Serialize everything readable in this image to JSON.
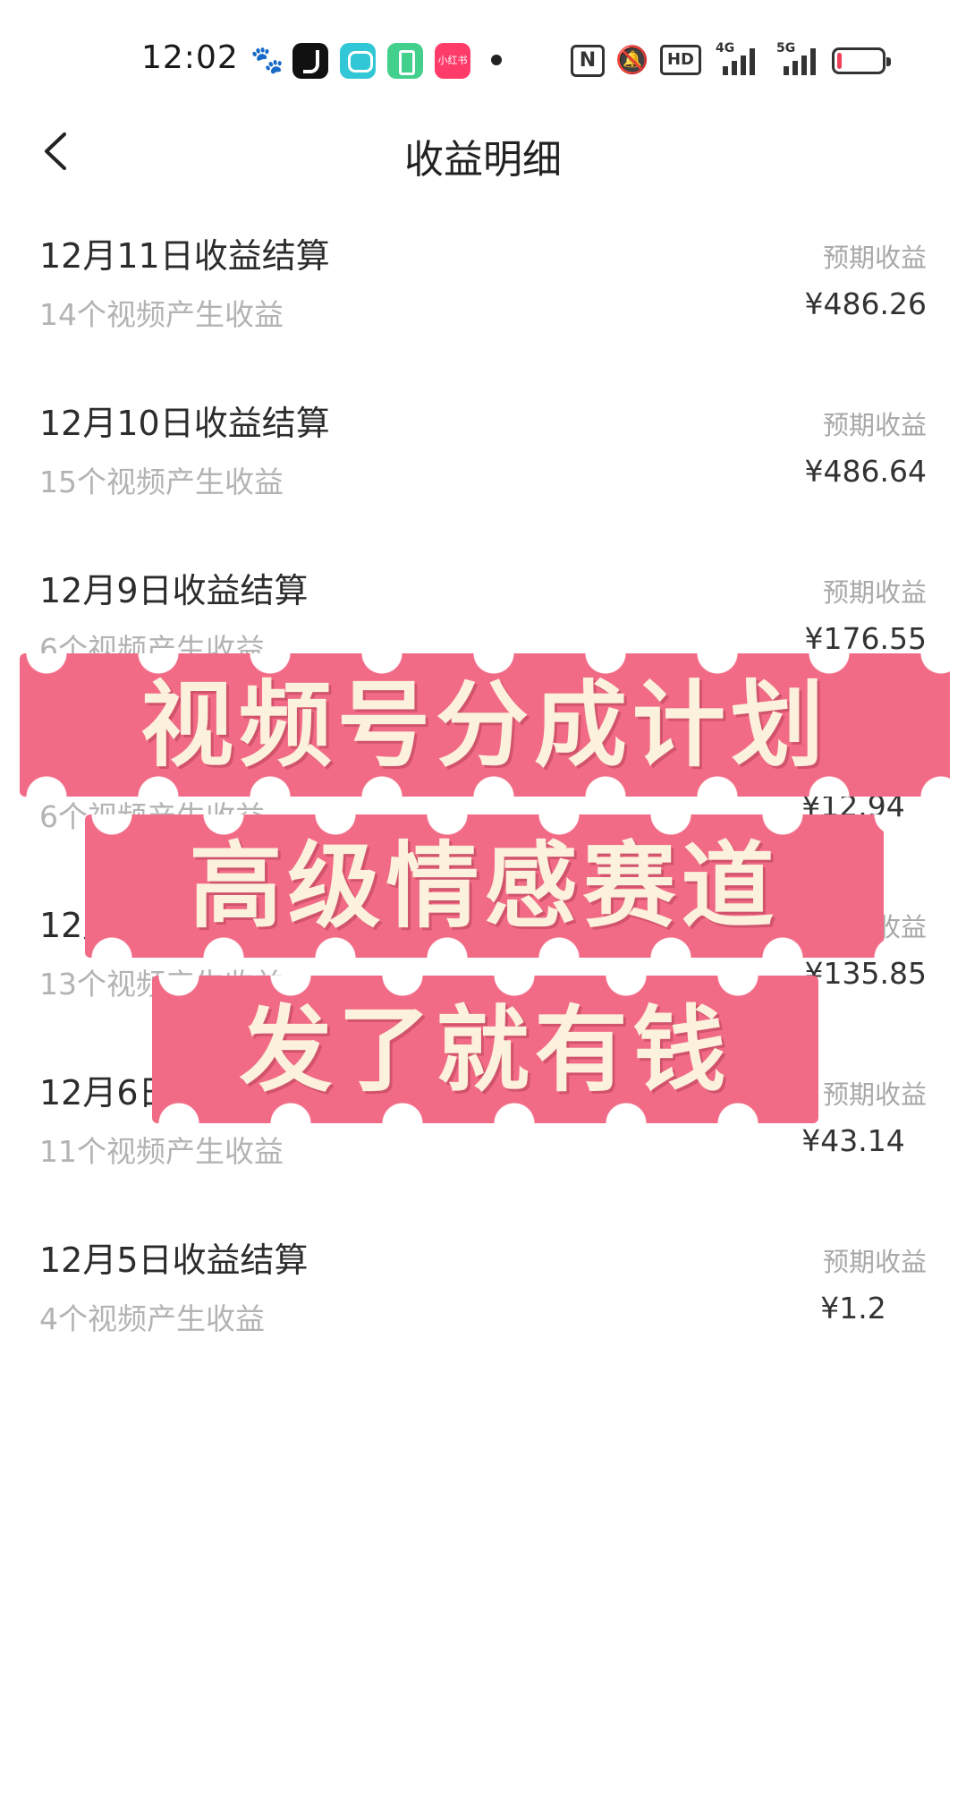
{
  "status_bar": {
    "time": "12:02",
    "apps": [
      "baidu-icon",
      "douyin-icon",
      "chat-app-icon",
      "green-app-icon",
      "xiaohongshu-icon"
    ],
    "xhs_label": "小红书",
    "hd_label": "HD",
    "network_4g": "4G",
    "network_5g": "5G",
    "battery_level": 0.1,
    "battery_color": "#f0415a"
  },
  "header": {
    "title": "收益明细"
  },
  "rows": [
    {
      "title": "12月11日收益结算",
      "sub": "14个视频产生收益",
      "label": "预期收益",
      "amount": "¥486.26"
    },
    {
      "title": "12月10日收益结算",
      "sub": "15个视频产生收益",
      "label": "预期收益",
      "amount": "¥486.64"
    },
    {
      "title": "12月9日收益结算",
      "sub": "6个视频产生收益",
      "label": "预期收益",
      "amount": "¥176.55"
    },
    {
      "title": "",
      "sub": "6个视频产生收益",
      "label": "",
      "amount": "¥12.94"
    },
    {
      "title": "12月",
      "sub": "13个视频产生收益",
      "label": "收益",
      "amount": "¥135.85"
    },
    {
      "title": "12月6日",
      "sub": "11个视频产生收益",
      "label": "预期收益",
      "amount": "¥43.14"
    },
    {
      "title": "12月5日收益结算",
      "sub": "4个视频产生收益",
      "label": "预期收益",
      "amount": "¥1.2"
    }
  ],
  "promo": {
    "line1": "视频号分成计划",
    "line2": "高级情感赛道",
    "line3": "发了就有钱",
    "band_color": "#f26b86",
    "text_color": "#fbf1dc"
  }
}
